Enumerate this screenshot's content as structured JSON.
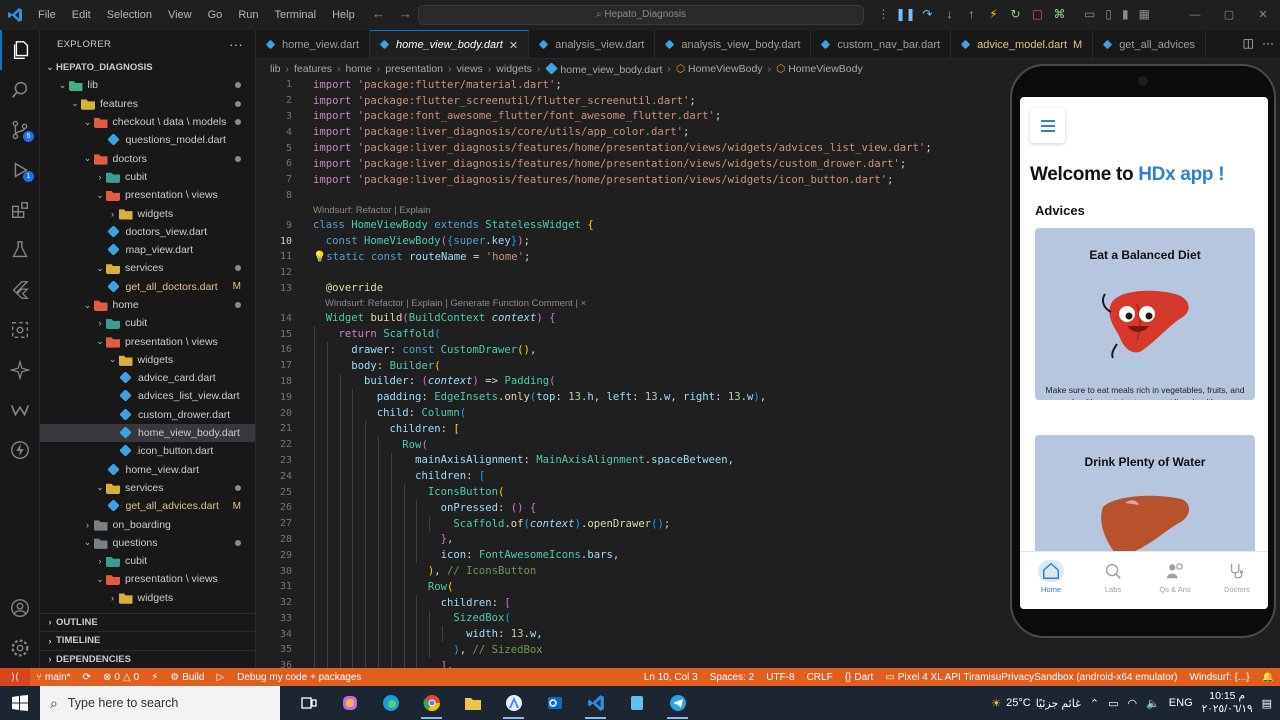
{
  "window": {
    "search_text": "Hepato_Diagnosis"
  },
  "menu": [
    "File",
    "Edit",
    "Selection",
    "View",
    "Go",
    "Run",
    "Terminal",
    "Help"
  ],
  "explorer": {
    "title": "EXPLORER",
    "project": "HEPATO_DIAGNOSIS",
    "tree": [
      {
        "label": "lib",
        "indent": 1,
        "type": "folder",
        "color": "green",
        "open": true,
        "dot": true
      },
      {
        "label": "features",
        "indent": 2,
        "type": "folder",
        "color": "gold",
        "open": true,
        "dot": true
      },
      {
        "label": "checkout \\ data \\ models",
        "indent": 3,
        "type": "folder",
        "color": "red",
        "open": true,
        "dot": true
      },
      {
        "label": "questions_model.dart",
        "indent": 5,
        "type": "dart"
      },
      {
        "label": "doctors",
        "indent": 3,
        "type": "folder",
        "color": "red",
        "open": true,
        "dot": true
      },
      {
        "label": "cubit",
        "indent": 4,
        "type": "folder",
        "color": "teal",
        "open": false
      },
      {
        "label": "presentation \\ views",
        "indent": 4,
        "type": "folder",
        "color": "red",
        "open": true
      },
      {
        "label": "widgets",
        "indent": 5,
        "type": "folder",
        "color": "gold",
        "open": false
      },
      {
        "label": "doctors_view.dart",
        "indent": 5,
        "type": "dart"
      },
      {
        "label": "map_view.dart",
        "indent": 5,
        "type": "dart"
      },
      {
        "label": "services",
        "indent": 4,
        "type": "folder",
        "color": "gold",
        "open": true,
        "dot": true
      },
      {
        "label": "get_all_doctors.dart",
        "indent": 5,
        "type": "dart",
        "mark": "M"
      },
      {
        "label": "home",
        "indent": 3,
        "type": "folder",
        "color": "red",
        "open": true,
        "dot": true
      },
      {
        "label": "cubit",
        "indent": 4,
        "type": "folder",
        "color": "teal",
        "open": false
      },
      {
        "label": "presentation \\ views",
        "indent": 4,
        "type": "folder",
        "color": "red",
        "open": true
      },
      {
        "label": "widgets",
        "indent": 5,
        "type": "folder",
        "color": "gold",
        "open": true
      },
      {
        "label": "advice_card.dart",
        "indent": 6,
        "type": "dart"
      },
      {
        "label": "advices_list_view.dart",
        "indent": 6,
        "type": "dart"
      },
      {
        "label": "custom_drower.dart",
        "indent": 6,
        "type": "dart"
      },
      {
        "label": "home_view_body.dart",
        "indent": 6,
        "type": "dart",
        "selected": true
      },
      {
        "label": "icon_button.dart",
        "indent": 6,
        "type": "dart"
      },
      {
        "label": "home_view.dart",
        "indent": 5,
        "type": "dart"
      },
      {
        "label": "services",
        "indent": 4,
        "type": "folder",
        "color": "gold",
        "open": true,
        "dot": true
      },
      {
        "label": "get_all_advices.dart",
        "indent": 5,
        "type": "dart",
        "mark": "M"
      },
      {
        "label": "on_boarding",
        "indent": 3,
        "type": "folder",
        "color": "plain",
        "open": false
      },
      {
        "label": "questions",
        "indent": 3,
        "type": "folder",
        "color": "plain",
        "open": true,
        "dot": true
      },
      {
        "label": "cubit",
        "indent": 4,
        "type": "folder",
        "color": "teal",
        "open": false
      },
      {
        "label": "presentation \\ views",
        "indent": 4,
        "type": "folder",
        "color": "red",
        "open": true
      },
      {
        "label": "widgets",
        "indent": 5,
        "type": "folder",
        "color": "gold",
        "open": false
      }
    ],
    "sections": [
      "OUTLINE",
      "TIMELINE",
      "DEPENDENCIES"
    ]
  },
  "tabs": [
    {
      "label": "home_view.dart"
    },
    {
      "label": "home_view_body.dart",
      "active": true
    },
    {
      "label": "analysis_view.dart"
    },
    {
      "label": "analysis_view_body.dart"
    },
    {
      "label": "custom_nav_bar.dart"
    },
    {
      "label": "advice_model.dart",
      "mark": "M"
    },
    {
      "label": "get_all_advices"
    }
  ],
  "breadcrumb": [
    "lib",
    "features",
    "home",
    "presentation",
    "views",
    "widgets",
    "home_view_body.dart",
    "HomeViewBody",
    "HomeViewBody"
  ],
  "code": {
    "lens1": "Windsurf: Refactor | Explain",
    "lens2": "Windsurf: Refactor | Explain | Generate Function Comment | ×",
    "lines": [
      {
        "n": "1",
        "html": "<span class='k'>import</span> <span class='s'>'package:flutter/material.dart'</span><span class='d'>;</span>"
      },
      {
        "n": "2",
        "html": "<span class='k'>import</span> <span class='s'>'package:flutter_screenutil/flutter_screenutil.dart'</span><span class='d'>;</span>"
      },
      {
        "n": "3",
        "html": "<span class='k'>import</span> <span class='s'>'package:font_awesome_flutter/font_awesome_flutter.dart'</span><span class='d'>;</span>"
      },
      {
        "n": "4",
        "html": "<span class='k'>import</span> <span class='s'>'package:liver_diagnosis/core/utils/app_color.dart'</span><span class='d'>;</span>"
      },
      {
        "n": "5",
        "html": "<span class='k'>import</span> <span class='s'>'package:liver_diagnosis/features/home/presentation/views/widgets/advices_list_view.dart'</span><span class='d'>;</span>"
      },
      {
        "n": "6",
        "html": "<span class='k'>import</span> <span class='s'>'package:liver_diagnosis/features/home/presentation/views/widgets/custom_drower.dart'</span><span class='d'>;</span>"
      },
      {
        "n": "7",
        "html": "<span class='k'>import</span> <span class='s'>'package:liver_diagnosis/features/home/presentation/views/widgets/icon_button.dart'</span><span class='d'>;</span>"
      },
      {
        "n": "8",
        "html": ""
      },
      {
        "lens": "lens1"
      },
      {
        "n": "9",
        "html": "<span class='kw'>class</span> <span class='t'>HomeViewBody</span> <span class='kw'>extends</span> <span class='t'>StatelessWidget</span> <span class='py'>{</span>"
      },
      {
        "n": "10",
        "cur": true,
        "html": "  <span class='kw'>const</span> <span class='t'>HomeViewBody</span><span class='pk'>(</span><span class='pb'>{</span><span class='kw'>super</span><span class='d'>.</span><span class='p'>key</span><span class='pb'>}</span><span class='pk'>)</span><span class='d'>;</span>"
      },
      {
        "n": "11",
        "html": "<span class='py'>💡</span><span class='kw'>static</span> <span class='kw'>const</span> <span class='p'>routeName</span> <span class='d'>=</span> <span class='s'>'home'</span><span class='d'>;</span>"
      },
      {
        "n": "12",
        "html": ""
      },
      {
        "n": "13",
        "html": "  <span class='dec'>@override</span>"
      },
      {
        "lens": "lens2"
      },
      {
        "n": "14",
        "html": "  <span class='t'>Widget</span> <span class='f'>build</span><span class='pk'>(</span><span class='t'>BuildContext</span> <span class='pi'>context</span><span class='pk'>)</span> <span class='pk'>{</span>"
      },
      {
        "n": "15",
        "html": "    <span class='k'>return</span> <span class='t'>Scaffold</span><span class='pb'>(</span>"
      },
      {
        "n": "16",
        "html": "      <span class='p'>drawer</span><span class='d'>:</span> <span class='kw'>const</span> <span class='t'>CustomDrawer</span><span class='py'>()</span><span class='d'>,</span>"
      },
      {
        "n": "17",
        "html": "      <span class='p'>body</span><span class='d'>:</span> <span class='t'>Builder</span><span class='py'>(</span>"
      },
      {
        "n": "18",
        "html": "        <span class='p'>builder</span><span class='d'>:</span> <span class='pk'>(</span><span class='pi'>context</span><span class='pk'>)</span> <span class='d'>=&gt;</span> <span class='t'>Padding</span><span class='pk'>(</span>"
      },
      {
        "n": "19",
        "html": "          <span class='p'>padding</span><span class='d'>:</span> <span class='t'>EdgeInsets</span><span class='d'>.</span><span class='f'>only</span><span class='pb'>(</span><span class='p'>top</span><span class='d'>:</span> <span class='n'>13</span><span class='d'>.</span><span class='p'>h</span><span class='d'>,</span> <span class='p'>left</span><span class='d'>:</span> <span class='n'>13</span><span class='d'>.</span><span class='p'>w</span><span class='d'>,</span> <span class='p'>right</span><span class='d'>:</span> <span class='n'>13</span><span class='d'>.</span><span class='p'>w</span><span class='pb'>)</span><span class='d'>,</span>"
      },
      {
        "n": "20",
        "html": "          <span class='p'>child</span><span class='d'>:</span> <span class='t'>Column</span><span class='pb'>(</span>"
      },
      {
        "n": "21",
        "html": "            <span class='p'>children</span><span class='d'>:</span> <span class='py'>[</span>"
      },
      {
        "n": "22",
        "html": "              <span class='t'>Row</span><span class='pk'>(</span>"
      },
      {
        "n": "23",
        "html": "                <span class='p'>mainAxisAlignment</span><span class='d'>:</span> <span class='t'>MainAxisAlignment</span><span class='d'>.</span><span class='p'>spaceBetween</span><span class='d'>,</span>"
      },
      {
        "n": "24",
        "html": "                <span class='p'>children</span><span class='d'>:</span> <span class='pb'>[</span>"
      },
      {
        "n": "25",
        "html": "                  <span class='t'>IconsButton</span><span class='py'>(</span>"
      },
      {
        "n": "26",
        "html": "                    <span class='p'>onPressed</span><span class='d'>:</span> <span class='pk'>()</span> <span class='pk'>{</span>"
      },
      {
        "n": "27",
        "html": "                      <span class='t'>Scaffold</span><span class='d'>.</span><span class='f'>of</span><span class='pb'>(</span><span class='pi'>context</span><span class='pb'>)</span><span class='d'>.</span><span class='f'>openDrawer</span><span class='pb'>()</span><span class='d'>;</span>"
      },
      {
        "n": "28",
        "html": "                    <span class='pk'>}</span><span class='d'>,</span>"
      },
      {
        "n": "29",
        "html": "                    <span class='p'>icon</span><span class='d'>:</span> <span class='t'>FontAwesomeIcons</span><span class='d'>.</span><span class='p'>bars</span><span class='d'>,</span>"
      },
      {
        "n": "30",
        "html": "                  <span class='py'>)</span><span class='d'>,</span> <span class='c'>// IconsButton</span>"
      },
      {
        "n": "31",
        "html": "                  <span class='t'>Row</span><span class='py'>(</span>"
      },
      {
        "n": "32",
        "html": "                    <span class='p'>children</span><span class='d'>:</span> <span class='pk'>[</span>"
      },
      {
        "n": "33",
        "html": "                      <span class='t'>SizedBox</span><span class='pb'>(</span>"
      },
      {
        "n": "34",
        "html": "                        <span class='p'>width</span><span class='d'>:</span> <span class='n'>13</span><span class='d'>.</span><span class='p'>w</span><span class='d'>,</span>"
      },
      {
        "n": "35",
        "html": "                      <span class='pb'>)</span><span class='d'>,</span> <span class='c'>// SizedBox</span>"
      },
      {
        "n": "36",
        "html": "                    <span class='pk'>]</span><span class='d'>,</span>"
      }
    ]
  },
  "phone": {
    "welcome_prefix": "Welcome to ",
    "welcome_app": "HDx app !",
    "advices_title": "Advices",
    "cards": [
      {
        "title": "Eat a Balanced Diet",
        "desc": "Make sure to eat meals rich in vegetables, fruits, and healthy proteins to support liver health."
      },
      {
        "title": "Drink Plenty of Water",
        "desc": ""
      }
    ],
    "nav": [
      {
        "label": "Home",
        "icon": "home-icon",
        "active": true
      },
      {
        "label": "Labs",
        "icon": "labs-icon"
      },
      {
        "label": "Qs & Ans",
        "icon": "qa-icon"
      },
      {
        "label": "Doctors",
        "icon": "doctors-icon"
      }
    ]
  },
  "statusbar": {
    "branch": "main*",
    "problems": "0",
    "warnings": "0",
    "build": "Build",
    "debug": "Debug my code + packages",
    "position": "Ln 10, Col 3",
    "spaces": "Spaces: 2",
    "encoding": "UTF-8",
    "eol": "CRLF",
    "language": "Dart",
    "device": "Pixel 4 XL API TiramisuPrivacySandbox (android-x64 emulator)",
    "windsurf": "Windsurf: {...}"
  },
  "taskbar": {
    "search_placeholder": "Type here to search",
    "weather": "25°C",
    "weather_desc": "غائم جزئيًا",
    "lang": "ENG",
    "time": "10:15 م",
    "date": "٢٠٢٥/٠٦/١٩"
  },
  "colors": {
    "accent": "#0078d4",
    "statusbar": "#e05f1f",
    "app_blue": "#2f80c9",
    "card": "#b7c6df"
  }
}
